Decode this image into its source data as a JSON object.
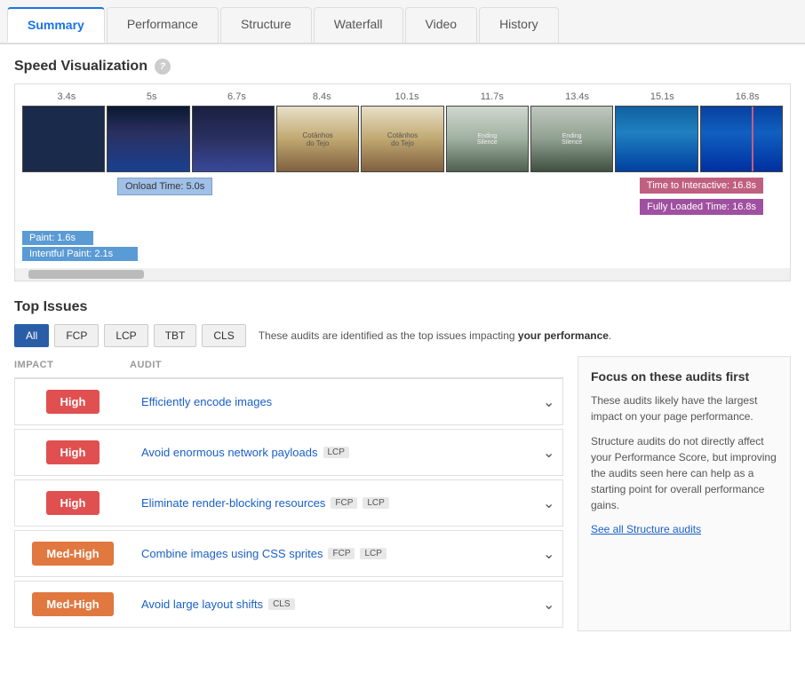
{
  "tabs": [
    {
      "label": "Summary",
      "active": true
    },
    {
      "label": "Performance",
      "active": false
    },
    {
      "label": "Structure",
      "active": false
    },
    {
      "label": "Waterfall",
      "active": false
    },
    {
      "label": "Video",
      "active": false
    },
    {
      "label": "History",
      "active": false
    }
  ],
  "speedViz": {
    "title": "Speed Visualization",
    "helpIcon": "?",
    "timelineLabels": [
      "3.4s",
      "5s",
      "6.7s",
      "8.4s",
      "10.1s",
      "11.7s",
      "13.4s",
      "15.1s",
      "16.8s"
    ],
    "annotations": {
      "onload": "Onload Time: 5.0s",
      "tti": "Time to Interactive: 16.8s",
      "fullyLoaded": "Fully Loaded Time: 16.8s"
    },
    "paintBars": {
      "firstPaint": "Paint: 1.6s",
      "meaningfulPaint": "Intentful Paint: 2.1s"
    }
  },
  "topIssues": {
    "title": "Top Issues",
    "filters": [
      "All",
      "FCP",
      "LCP",
      "TBT",
      "CLS"
    ],
    "activeFilter": "All",
    "description": "These audits are identified as the top issues impacting",
    "descriptionBold": "your performance",
    "descriptionEnd": ".",
    "columns": {
      "impact": "IMPACT",
      "audit": "AUDIT"
    },
    "issues": [
      {
        "impact": "High",
        "impactClass": "high",
        "audit": "Efficiently encode images",
        "tags": []
      },
      {
        "impact": "High",
        "impactClass": "high",
        "audit": "Avoid enormous network payloads",
        "tags": [
          "LCP"
        ]
      },
      {
        "impact": "High",
        "impactClass": "high",
        "audit": "Eliminate render-blocking resources",
        "tags": [
          "FCP",
          "LCP"
        ]
      },
      {
        "impact": "Med-High",
        "impactClass": "med-high",
        "audit": "Combine images using CSS sprites",
        "tags": [
          "FCP",
          "LCP"
        ]
      },
      {
        "impact": "Med-High",
        "impactClass": "med-high",
        "audit": "Avoid large layout shifts",
        "tags": [
          "CLS"
        ]
      }
    ],
    "focusBox": {
      "title": "Focus on these audits first",
      "text1": "These audits likely have the largest impact on your page performance.",
      "text2": "Structure audits do not directly affect your Performance Score, but improving the audits seen here can help as a starting point for overall performance gains.",
      "linkText": "See all Structure audits"
    }
  }
}
